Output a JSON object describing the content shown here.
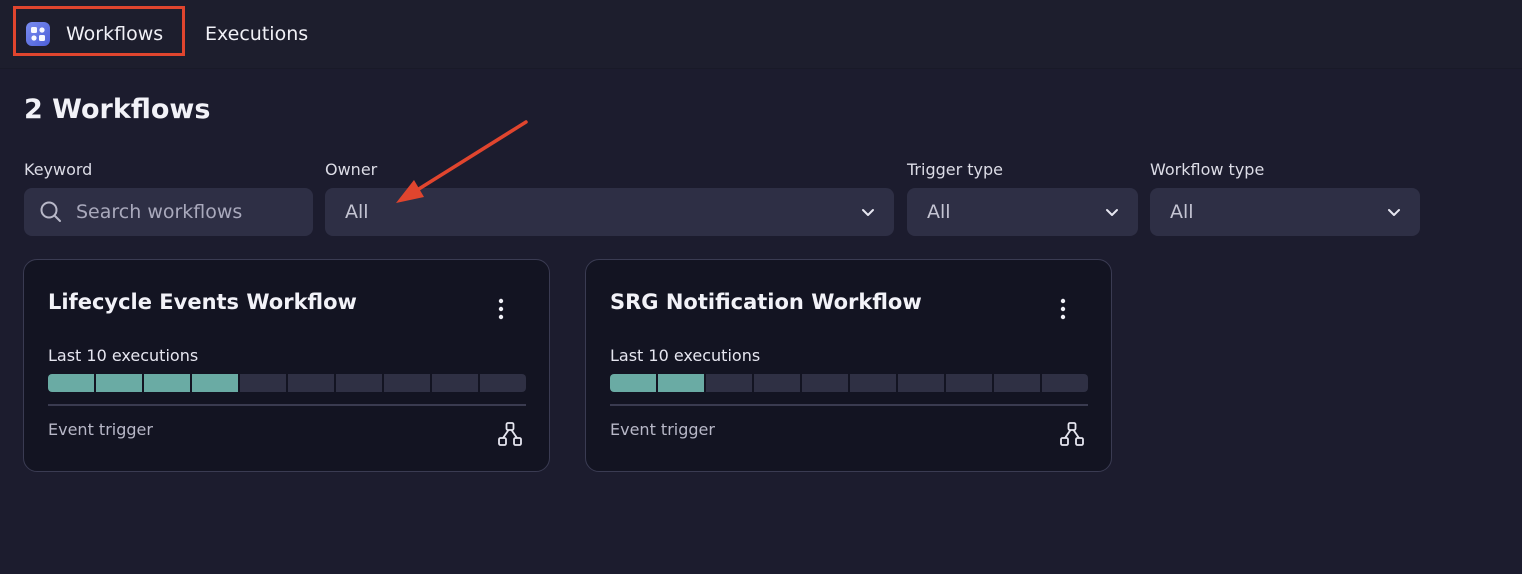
{
  "nav": {
    "tabs": [
      {
        "label": "Workflows",
        "active": true
      },
      {
        "label": "Executions",
        "active": false
      }
    ]
  },
  "page": {
    "heading": "2 Workflows"
  },
  "filters": {
    "keyword": {
      "label": "Keyword",
      "placeholder": "Search workflows"
    },
    "owner": {
      "label": "Owner",
      "value": "All"
    },
    "trigger_type": {
      "label": "Trigger type",
      "value": "All"
    },
    "workflow_type": {
      "label": "Workflow type",
      "value": "All"
    }
  },
  "workflows": [
    {
      "title": "Lifecycle Events Workflow",
      "executions_label": "Last 10 executions",
      "executions": [
        "success",
        "success",
        "success",
        "success",
        "none",
        "none",
        "none",
        "none",
        "none",
        "none"
      ],
      "trigger": "Event trigger"
    },
    {
      "title": "SRG Notification Workflow",
      "executions_label": "Last 10 executions",
      "executions": [
        "success",
        "success",
        "none",
        "none",
        "none",
        "none",
        "none",
        "none",
        "none",
        "none"
      ],
      "trigger": "Event trigger"
    }
  ],
  "colors": {
    "background": "#1c1c2e",
    "card_background": "#131422",
    "filter_background": "#2e2f45",
    "execution_success": "#6aaba4",
    "execution_empty": "#2f3044",
    "annotation_red": "#e0452e"
  },
  "icons": {
    "app": "workflows-app-icon",
    "search": "search-icon",
    "dropdown": "chevron-down-icon",
    "menu": "more-vertical-icon",
    "workflow": "workflow-diagram-icon"
  }
}
